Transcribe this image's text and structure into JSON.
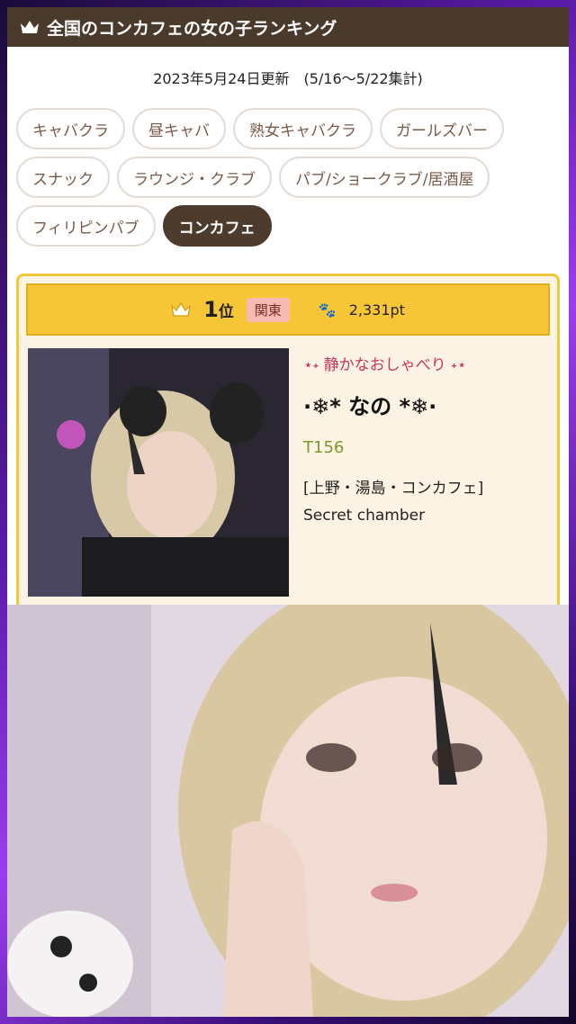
{
  "header": {
    "title": "全国のコンカフェの女の子ランキング",
    "icon": "crown-icon"
  },
  "updated_text": "2023年5月24日更新　(5/16〜5/22集計)",
  "categories": [
    {
      "label": "キャバクラ",
      "active": false
    },
    {
      "label": "昼キャバ",
      "active": false
    },
    {
      "label": "熟女キャバクラ",
      "active": false
    },
    {
      "label": "ガールズバー",
      "active": false
    },
    {
      "label": "スナック",
      "active": false
    },
    {
      "label": "ラウンジ・クラブ",
      "active": false
    },
    {
      "label": "パブ/ショークラブ/居酒屋",
      "active": false
    },
    {
      "label": "フィリピンパブ",
      "active": false
    },
    {
      "label": "コンカフェ",
      "active": true
    }
  ],
  "ranking": {
    "rank": "1",
    "rank_suffix": "位",
    "region": "関東",
    "points": "2,331pt",
    "catchphrase": "⋆˖ 静かなおしゃべり ˖⋆",
    "name": "·❄* なの *❄·",
    "height": "T156",
    "area": "[上野・湯島・コンカフェ]",
    "shop": "Secret chamber"
  },
  "colors": {
    "header_bg": "#4a3a2c",
    "active_chip": "#4d3b2d",
    "rank_bar": "#f7c637",
    "region_badge": "#f6b9b4",
    "catch_text": "#c8355b",
    "height_text": "#7a9a2a"
  }
}
